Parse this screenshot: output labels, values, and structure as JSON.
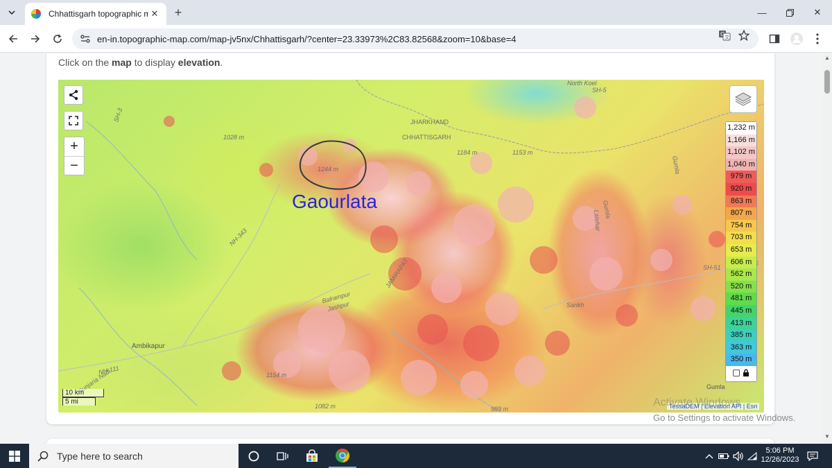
{
  "browser": {
    "tab_title": "Chhattisgarh topographic map,",
    "url": "en-in.topographic-map.com/map-jv5nx/Chhattisgarh/?center=23.33973%2C83.82568&zoom=10&base=4"
  },
  "page": {
    "hint_prefix": "Click on the ",
    "hint_map": "map",
    "hint_middle": " to display ",
    "hint_elevation": "elevation",
    "hint_suffix": "."
  },
  "map": {
    "annotation": "Gaourlata",
    "places": {
      "jharkhand": "JHARKHAND",
      "chhattisgarh": "CHHATTISGARH",
      "ambikapur": "Ambikapur",
      "balrampur": "Balrampur",
      "jashpur": "Jashpur",
      "jamirapat": "JAMIRAPAT",
      "sankh": "Sankh",
      "gumla1": "Gumla",
      "gumla2": "Gumla",
      "gumla3": "Gumla",
      "gumla_town": "Gumla",
      "latehar": "Latehar",
      "sh3": "SH-3",
      "sh5": "SH-5",
      "sh51": "SH-51",
      "nh343": "NH-343",
      "nh111": "NH-111",
      "gunjaria": "Gunjaria Nadi",
      "north": "North Koel",
      "e1028": "1028 m",
      "e1244": "1244 m",
      "e1184": "1184 m",
      "e1153": "1153 m",
      "e1154": "1154 m",
      "e1082": "1082 m",
      "e989": "989 m"
    },
    "legend": [
      "1,232 m",
      "1,166 m",
      "1,102 m",
      "1,040 m",
      "979 m",
      "920 m",
      "863 m",
      "807 m",
      "754 m",
      "703 m",
      "653 m",
      "606 m",
      "562 m",
      "520 m",
      "481 m",
      "445 m",
      "413 m",
      "385 m",
      "363 m",
      "350 m"
    ],
    "legend_colors": [
      "#ffffff",
      "#f7dede",
      "#f4c7c7",
      "#f0b3b3",
      "#ef5a5a",
      "#ee4b4b",
      "#f07a55",
      "#f4a64b",
      "#f7c64b",
      "#f4dd4b",
      "#e7ec4b",
      "#c9ec4b",
      "#a9e84b",
      "#86e04b",
      "#5edc4b",
      "#44d46b",
      "#3cd29a",
      "#3ccfbf",
      "#40c8dc",
      "#4ab8ef"
    ],
    "scale_km": "10 km",
    "scale_mi": "5 mi",
    "attribution": "TessaDEM | Elevation API | Esri"
  },
  "watermark": {
    "line1": "Activate Windows",
    "line2": "Go to Settings to activate Windows."
  },
  "taskbar": {
    "search_placeholder": "Type here to search",
    "time": "5:06 PM",
    "date": "12/26/2023"
  }
}
